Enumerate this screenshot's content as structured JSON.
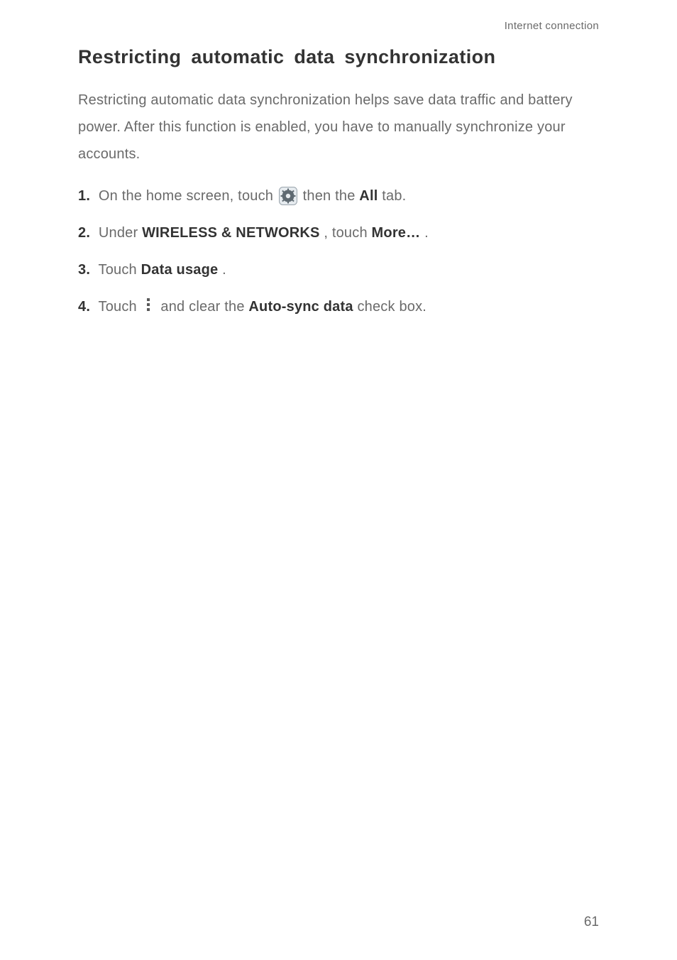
{
  "header": {
    "breadcrumb": "Internet connection"
  },
  "heading": "Restricting automatic data synchronization",
  "intro": "Restricting automatic data synchronization helps save data traffic and battery power. After this function is enabled, you have to manually synchronize your accounts.",
  "steps": {
    "s1": {
      "num": "1.",
      "pre": "On the home screen, touch ",
      "mid": " then the ",
      "boldAll": "All",
      "post": " tab."
    },
    "s2": {
      "num": "2.",
      "pre": "Under ",
      "b1": "WIRELESS & NETWORKS",
      "mid": ", touch ",
      "b2": "More…",
      "post": "."
    },
    "s3": {
      "num": "3.",
      "pre": "Touch ",
      "b1": "Data usage",
      "post": "."
    },
    "s4": {
      "num": "4.",
      "pre": "Touch ",
      "mid": " and clear the ",
      "b1": "Auto-sync data",
      "post": " check box."
    }
  },
  "pageNumber": "61"
}
